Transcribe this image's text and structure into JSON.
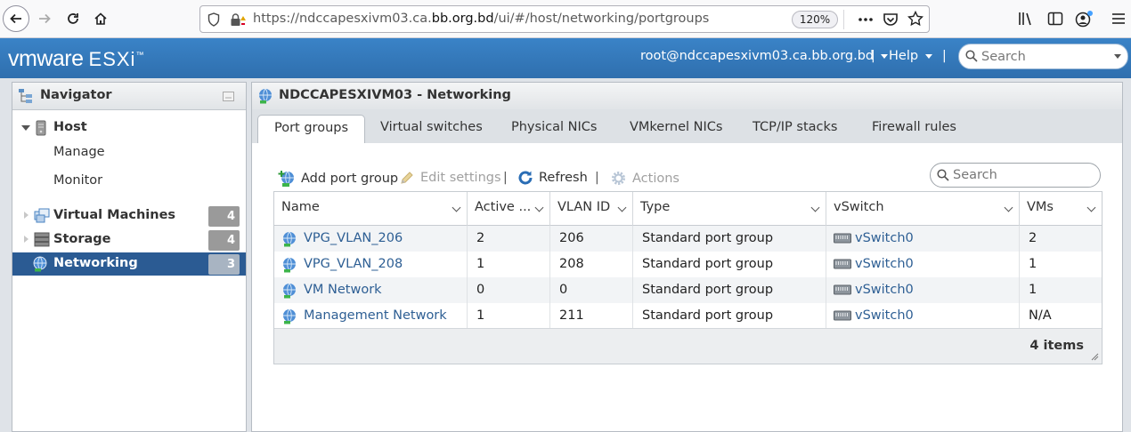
{
  "browser": {
    "url_prefix": "https://ndccapesxivm03.ca.",
    "url_domain": "bb.org.bd",
    "url_path": "/ui/#/host/networking/portgroups",
    "zoom": "120%"
  },
  "header": {
    "brand_vm": "vmware",
    "brand_product": "ESXi",
    "user": "root@ndccapesxivm03.ca.bb.org.bd",
    "help": "Help",
    "search_placeholder": "Search"
  },
  "navigator": {
    "title": "Navigator",
    "host": "Host",
    "manage": "Manage",
    "monitor": "Monitor",
    "items": [
      {
        "label": "Virtual Machines",
        "count": "4"
      },
      {
        "label": "Storage",
        "count": "4"
      },
      {
        "label": "Networking",
        "count": "3"
      }
    ]
  },
  "main": {
    "title": "NDCCAPESXIVM03 - Networking",
    "tabs": [
      "Port groups",
      "Virtual switches",
      "Physical NICs",
      "VMkernel NICs",
      "TCP/IP stacks",
      "Firewall rules"
    ],
    "toolbar": {
      "add": "Add port group",
      "edit": "Edit settings",
      "refresh": "Refresh",
      "actions": "Actions",
      "search_placeholder": "Search"
    },
    "columns": [
      "Name",
      "Active ...",
      "VLAN ID",
      "Type",
      "vSwitch",
      "VMs"
    ],
    "rows": [
      {
        "name": "VPG_VLAN_206",
        "active": "2",
        "vlan": "206",
        "type": "Standard port group",
        "vswitch": "vSwitch0",
        "vms": "2"
      },
      {
        "name": "VPG_VLAN_208",
        "active": "1",
        "vlan": "208",
        "type": "Standard port group",
        "vswitch": "vSwitch0",
        "vms": "1"
      },
      {
        "name": "VM Network",
        "active": "0",
        "vlan": "0",
        "type": "Standard port group",
        "vswitch": "vSwitch0",
        "vms": "1"
      },
      {
        "name": "Management Network",
        "active": "1",
        "vlan": "211",
        "type": "Standard port group",
        "vswitch": "vSwitch0",
        "vms": "N/A"
      }
    ],
    "footer": "4 items"
  }
}
